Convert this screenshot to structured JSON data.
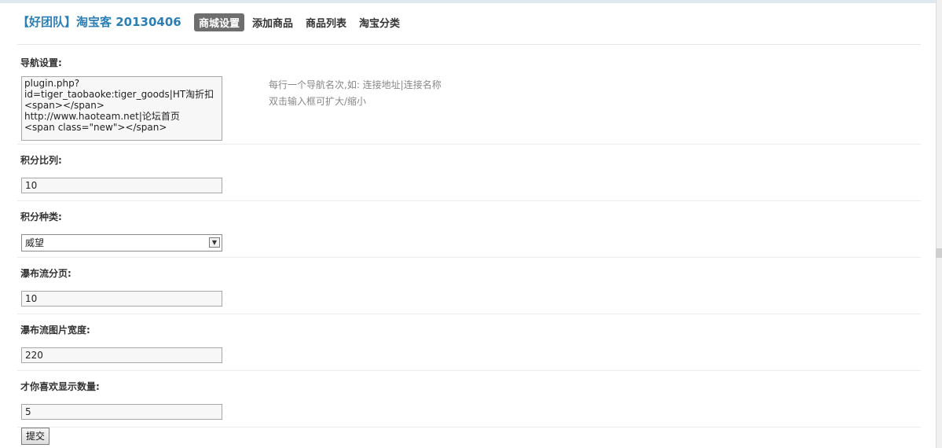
{
  "header": {
    "title": "【好团队】淘宝客 20130406",
    "tabs": [
      {
        "label": "商城设置",
        "active": true
      },
      {
        "label": "添加商品",
        "active": false
      },
      {
        "label": "商品列表",
        "active": false
      },
      {
        "label": "淘宝分类",
        "active": false
      }
    ]
  },
  "form": {
    "nav_settings": {
      "label": "导航设置:",
      "value_lines": [
        "plugin.php?",
        "id=tiger_taobaoke:tiger_goods|HT淘折扣<span></span>",
        "http://www.haoteam.net|论坛首页",
        "<span class=\"new\"></span>"
      ],
      "hint_lines": [
        "每行一个导航名次,如:  连接地址|连接名称",
        "双击输入框可扩大/缩小"
      ]
    },
    "points_ratio": {
      "label": "积分比列:",
      "value": "10"
    },
    "points_type": {
      "label": "积分种类:",
      "selected": "威望"
    },
    "waterfall_page": {
      "label": "瀑布流分页:",
      "value": "10"
    },
    "waterfall_image_width": {
      "label": "瀑布流图片宽度:",
      "value": "220"
    },
    "recommend_count": {
      "label": "才你喜欢显示数量:",
      "value": "5"
    },
    "submit_label": "提交"
  },
  "colors": {
    "brand": "#2b7fb5",
    "active_tab_bg": "#6e6e6e"
  }
}
